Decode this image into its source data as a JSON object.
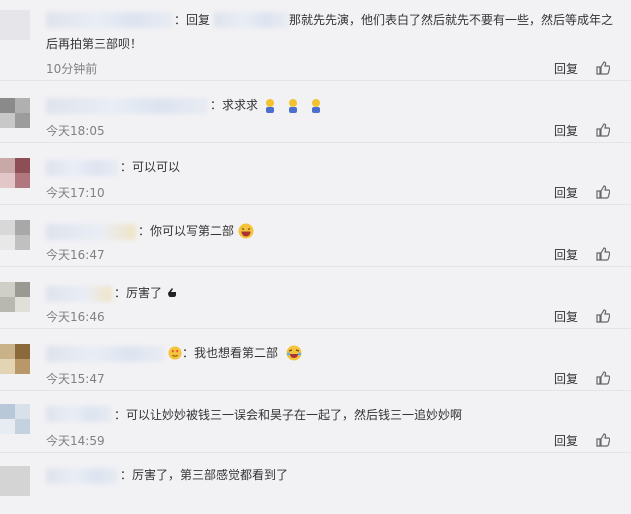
{
  "comments": [
    {
      "text": "：回复",
      "text2": "那就先先演，他们表白了然后就先不要有一些，然后等成年之",
      "text3": "后再拍第三部呗！",
      "time": "10分钟前",
      "reply": "回复"
    },
    {
      "text": "：求求求",
      "time": "今天18:05",
      "reply": "回复",
      "emoji": "yellow-figure-icon"
    },
    {
      "text": "：可以可以",
      "time": "今天17:10",
      "reply": "回复"
    },
    {
      "text": "：你可以写第二部",
      "time": "今天16:47",
      "reply": "回复",
      "emoji": "laughing-face-icon"
    },
    {
      "text": "：厉害了",
      "time": "今天16:46",
      "reply": "回复",
      "emoji": "hand-icon"
    },
    {
      "text": "：我也想看第二部",
      "time": "今天15:47",
      "reply": "回复",
      "emoji": "laugh-cry-icon"
    },
    {
      "text": "：可以让妙妙被钱三一误会和昊子在一起了，然后钱三一追妙妙啊",
      "time": "今天14:59",
      "reply": "回复"
    },
    {
      "text": "：厉害了，第三部感觉都看到了"
    }
  ]
}
